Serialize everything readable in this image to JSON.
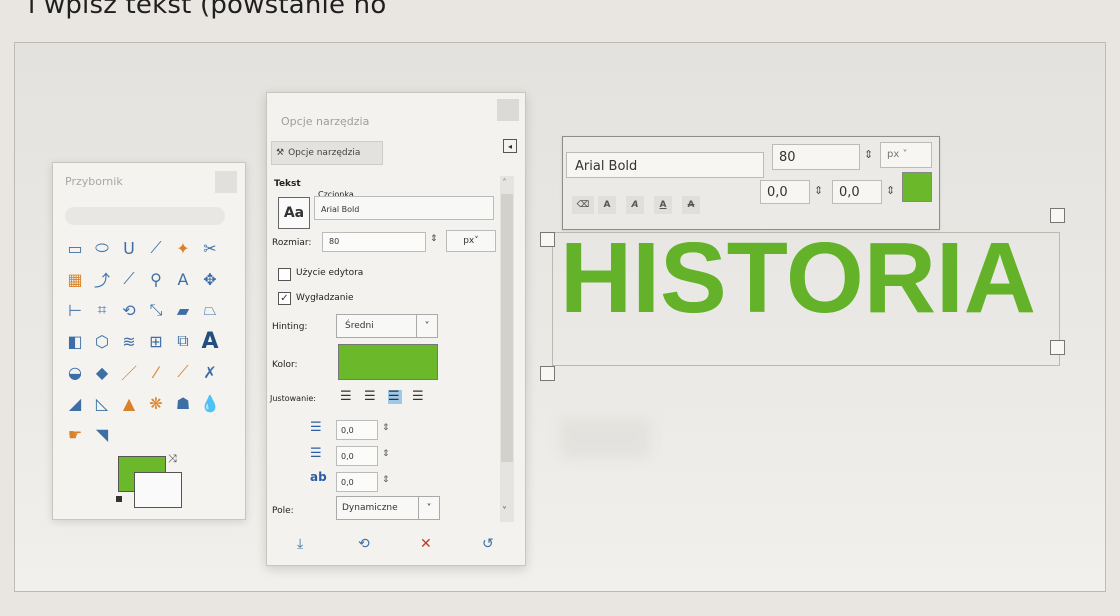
{
  "caption": "i wpisz tekst (powstanie no",
  "toolbox": {
    "title": "Przybornik",
    "tools": [
      "rect-select",
      "ellipse-select",
      "free-select",
      "fuzzy-select",
      "color-select",
      "scissors",
      "foreground-select",
      "paths",
      "color-picker",
      "zoom",
      "measure",
      "move",
      "align",
      "crop",
      "rotate",
      "scale",
      "shear",
      "perspective",
      "flip",
      "cage",
      "warp",
      "unified-transform",
      "handle-transform",
      "text",
      "bucket-fill",
      "gradient",
      "pencil",
      "paintbrush",
      "eraser",
      "airbrush",
      "ink",
      "mypaint-brush",
      "clone",
      "heal",
      "perspective-clone",
      "blur",
      "smudge",
      "dodge-burn"
    ],
    "fg_color": "#6bb92a",
    "bg_color": "#fafafa"
  },
  "options": {
    "dock_title": "Opcje narzędzia",
    "tab_label": "Opcje narzędzia",
    "section_text": "Tekst",
    "font_label": "Czcionka",
    "font_value": "Arial Bold",
    "aa_label": "Aa",
    "size_label": "Rozmiar:",
    "size_value": "80",
    "size_unit": "px",
    "use_editor_label": "Użycie edytora",
    "use_editor_checked": false,
    "antialias_label": "Wygładzanie",
    "antialias_checked": true,
    "hinting_label": "Hinting:",
    "hinting_value": "Średni",
    "color_label": "Kolor:",
    "color_value": "#6bb92a",
    "justify_label": "Justowanie:",
    "indent_value": "0,0",
    "line_spacing_value": "0,0",
    "letter_spacing_value": "0,0",
    "letter_icon": "ab",
    "box_label": "Pole:",
    "box_value": "Dynamiczne"
  },
  "canvas": {
    "font_value": "Arial Bold",
    "size_value": "80",
    "unit_value": "px",
    "baseline_value": "0,0",
    "kerning_value": "0,0",
    "style_buttons": [
      "A",
      "A",
      "A",
      "A"
    ],
    "text_color": "#6bb92a",
    "text": "HISTORIA"
  }
}
